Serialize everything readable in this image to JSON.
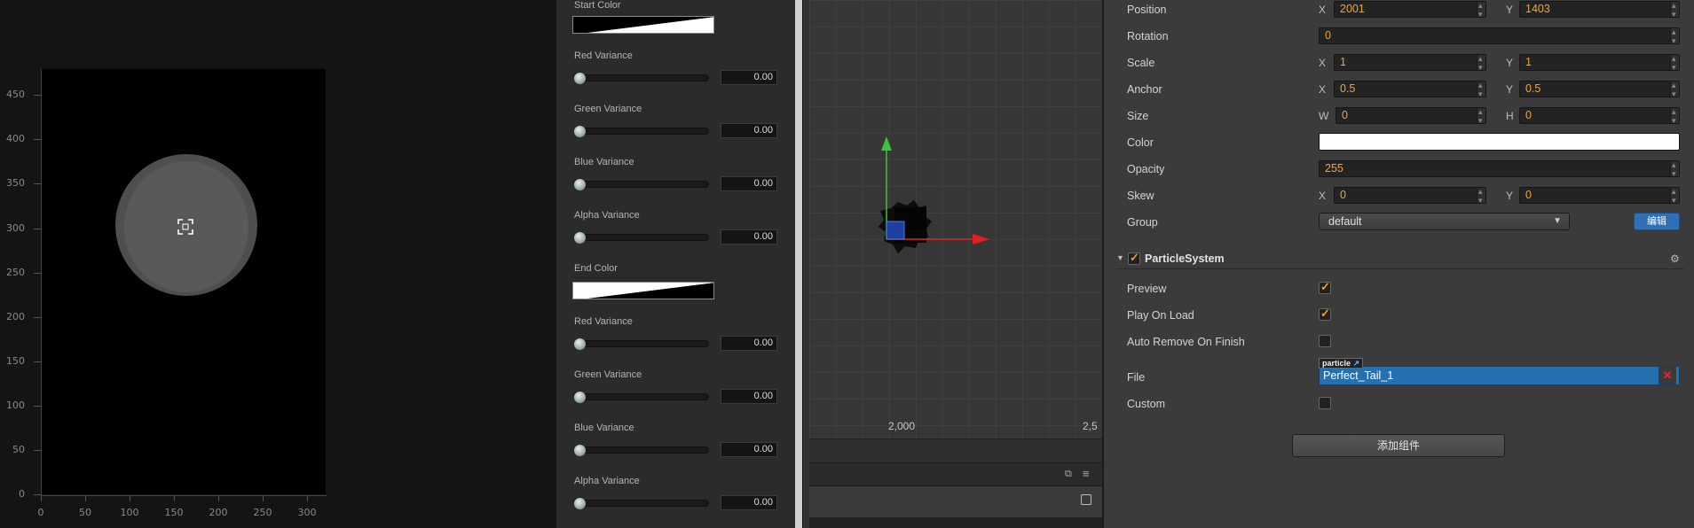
{
  "preview": {
    "y_ticks": [
      "450",
      "400",
      "350",
      "300",
      "250",
      "200",
      "150",
      "100",
      "50",
      "0"
    ],
    "x_ticks": [
      "0",
      "50",
      "100",
      "150",
      "200",
      "250",
      "300"
    ]
  },
  "particle_props": {
    "start_color_label": "Start Color",
    "end_color_label": "End Color",
    "start_variances": [
      {
        "label": "Red Variance",
        "value": "0.00"
      },
      {
        "label": "Green Variance",
        "value": "0.00"
      },
      {
        "label": "Blue Variance",
        "value": "0.00"
      },
      {
        "label": "Alpha Variance",
        "value": "0.00"
      }
    ],
    "end_variances": [
      {
        "label": "Red Variance",
        "value": "0.00"
      },
      {
        "label": "Green Variance",
        "value": "0.00"
      },
      {
        "label": "Blue Variance",
        "value": "0.00"
      },
      {
        "label": "Alpha Variance",
        "value": "0.00"
      }
    ]
  },
  "scene": {
    "ruler_labels": [
      "2,000",
      "2,5"
    ]
  },
  "inspector": {
    "position": {
      "label": "Position",
      "x_label": "X",
      "x": "2001",
      "y_label": "Y",
      "y": "1403"
    },
    "rotation": {
      "label": "Rotation",
      "value": "0"
    },
    "scale": {
      "label": "Scale",
      "x_label": "X",
      "x": "1",
      "y_label": "Y",
      "y": "1"
    },
    "anchor": {
      "label": "Anchor",
      "x_label": "X",
      "x": "0.5",
      "y_label": "Y",
      "y": "0.5"
    },
    "size": {
      "label": "Size",
      "w_label": "W",
      "w": "0",
      "h_label": "H",
      "h": "0"
    },
    "color": {
      "label": "Color",
      "value": "#ffffff"
    },
    "opacity": {
      "label": "Opacity",
      "value": "255"
    },
    "skew": {
      "label": "Skew",
      "x_label": "X",
      "x": "0",
      "y_label": "Y",
      "y": "0"
    },
    "group": {
      "label": "Group",
      "value": "default",
      "edit_label": "编辑"
    },
    "particle_system": {
      "title": "ParticleSystem",
      "enabled": true,
      "preview": {
        "label": "Preview",
        "checked": true
      },
      "play_on_load": {
        "label": "Play On Load",
        "checked": true
      },
      "auto_remove": {
        "label": "Auto Remove On Finish",
        "checked": false
      },
      "file": {
        "label": "File",
        "tag": "particle",
        "value": "Perfect_Tail_1"
      },
      "custom": {
        "label": "Custom",
        "checked": false
      }
    },
    "add_component_label": "添加组件"
  },
  "colors": {
    "accent_orange": "#f0a43a",
    "selection_blue": "#2570b0",
    "gizmo_green": "#3cc23c",
    "gizmo_red": "#e02020"
  }
}
